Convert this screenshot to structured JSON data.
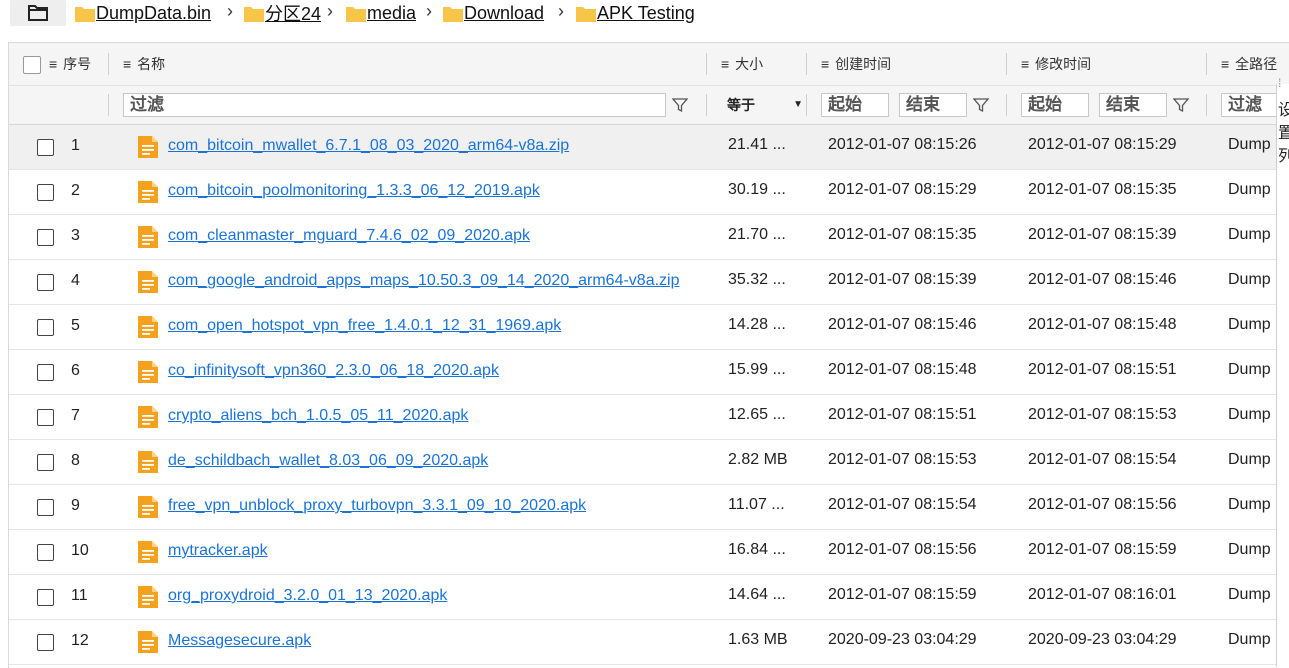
{
  "breadcrumb": {
    "items": [
      {
        "label": "DumpData.bin"
      },
      {
        "label": "分区24"
      },
      {
        "label": "media"
      },
      {
        "label": "Download"
      },
      {
        "label": "APK Testing"
      }
    ],
    "separator": "›"
  },
  "columns": {
    "index": "序号",
    "name": "名称",
    "size": "大小",
    "created": "创建时间",
    "modified": "修改时间",
    "path": "全路径"
  },
  "filters": {
    "name_placeholder": "过滤",
    "size_operator": "等于",
    "created_start": "起始",
    "created_end": "结束",
    "modified_start": "起始",
    "modified_end": "结束",
    "path_placeholder": "过滤"
  },
  "side_panel": {
    "chars": [
      "设",
      "置",
      "列"
    ],
    "handle": "⁞"
  },
  "rows": [
    {
      "index": "1",
      "name": "com_bitcoin_mwallet_6.7.1_08_03_2020_arm64-v8a.zip",
      "size": "21.41 ...",
      "created": "2012-01-07 08:15:26",
      "modified": "2012-01-07 08:15:29",
      "path": "Dump",
      "selected": true
    },
    {
      "index": "2",
      "name": "com_bitcoin_poolmonitoring_1.3.3_06_12_2019.apk",
      "size": "30.19 ...",
      "created": "2012-01-07 08:15:29",
      "modified": "2012-01-07 08:15:35",
      "path": "Dump"
    },
    {
      "index": "3",
      "name": "com_cleanmaster_mguard_7.4.6_02_09_2020.apk",
      "size": "21.70 ...",
      "created": "2012-01-07 08:15:35",
      "modified": "2012-01-07 08:15:39",
      "path": "Dump"
    },
    {
      "index": "4",
      "name": "com_google_android_apps_maps_10.50.3_09_14_2020_arm64-v8a.zip",
      "size": "35.32 ...",
      "created": "2012-01-07 08:15:39",
      "modified": "2012-01-07 08:15:46",
      "path": "Dump"
    },
    {
      "index": "5",
      "name": "com_open_hotspot_vpn_free_1.4.0.1_12_31_1969.apk",
      "size": "14.28 ...",
      "created": "2012-01-07 08:15:46",
      "modified": "2012-01-07 08:15:48",
      "path": "Dump"
    },
    {
      "index": "6",
      "name": "co_infinitysoft_vpn360_2.3.0_06_18_2020.apk",
      "size": "15.99 ...",
      "created": "2012-01-07 08:15:48",
      "modified": "2012-01-07 08:15:51",
      "path": "Dump"
    },
    {
      "index": "7",
      "name": "crypto_aliens_bch_1.0.5_05_11_2020.apk",
      "size": "12.65 ...",
      "created": "2012-01-07 08:15:51",
      "modified": "2012-01-07 08:15:53",
      "path": "Dump"
    },
    {
      "index": "8",
      "name": "de_schildbach_wallet_8.03_06_09_2020.apk",
      "size": "2.82 MB",
      "created": "2012-01-07 08:15:53",
      "modified": "2012-01-07 08:15:54",
      "path": "Dump"
    },
    {
      "index": "9",
      "name": "free_vpn_unblock_proxy_turbovpn_3.3.1_09_10_2020.apk",
      "size": "11.07 ...",
      "created": "2012-01-07 08:15:54",
      "modified": "2012-01-07 08:15:56",
      "path": "Dump"
    },
    {
      "index": "10",
      "name": "mytracker.apk",
      "size": "16.84 ...",
      "created": "2012-01-07 08:15:56",
      "modified": "2012-01-07 08:15:59",
      "path": "Dump"
    },
    {
      "index": "11",
      "name": "org_proxydroid_3.2.0_01_13_2020.apk",
      "size": "14.64 ...",
      "created": "2012-01-07 08:15:59",
      "modified": "2012-01-07 08:16:01",
      "path": "Dump"
    },
    {
      "index": "12",
      "name": "Messagesecure.apk",
      "size": "1.63 MB",
      "created": "2020-09-23 03:04:29",
      "modified": "2020-09-23 03:04:29",
      "path": "Dump"
    }
  ],
  "colors": {
    "folder": "#f7c548",
    "file_icon": "#f4a11d",
    "link": "#1a73d9"
  }
}
